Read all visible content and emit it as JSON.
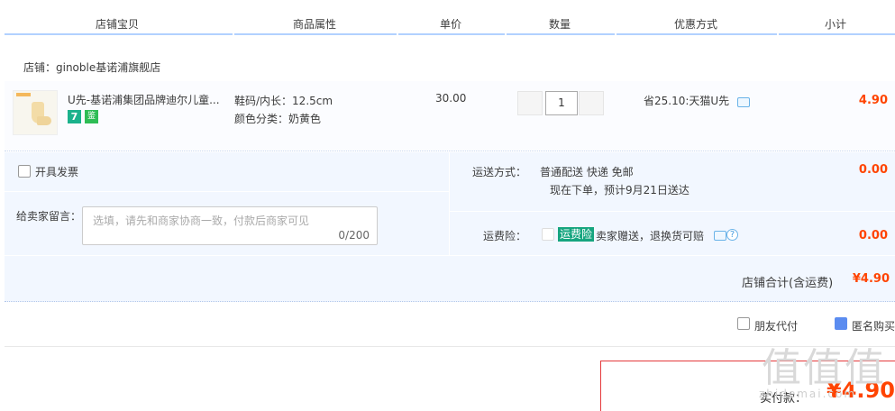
{
  "header": {
    "columns": [
      "店铺宝贝",
      "商品属性",
      "单价",
      "数量",
      "优惠方式",
      "小计"
    ]
  },
  "shop": {
    "label": "店铺：ginoble基诺浦旗舰店"
  },
  "item": {
    "title": "U先-基诺浦集团品牌迪尔儿童...",
    "badge_7": "7",
    "badge_g": "鉴",
    "attr_size": "鞋码/内长：12.5cm",
    "attr_color": "颜色分类：奶黄色",
    "price": "30.00",
    "quantity": "1",
    "promo": "省25.10:天猫U先",
    "subtotal": "4.90"
  },
  "options": {
    "invoice_label": "开具发票",
    "message_label": "给卖家留言：",
    "message_placeholder": "选填，请先和商家协商一致，付款后商家可见",
    "message_count": "0/200",
    "shipping_label": "运送方式：",
    "shipping_method": "普通配送 快递 免邮",
    "shipping_eta": "现在下单，预计9月21日送达",
    "shipping_cost": "0.00",
    "insurance_label": "运费险：",
    "insurance_tag": "运费险",
    "insurance_desc": "卖家赠送，退换货可赔",
    "insurance_cost": "0.00",
    "shop_total_label": "店铺合计(含运费)",
    "shop_total_value": "¥4.90"
  },
  "footer": {
    "friend_pay_label": "朋友代付",
    "anonymous_label": "匿名购买",
    "actual_pay_label": "实付款：",
    "actual_pay_value": "¥4.90"
  },
  "watermark": {
    "text": "值值值",
    "url": "zhidemai.com"
  },
  "colors": {
    "accent": "#ff4400",
    "header_line": "#b2d1ff",
    "panel_bg": "#f2f7ff",
    "checked": "#5b8cf0"
  }
}
